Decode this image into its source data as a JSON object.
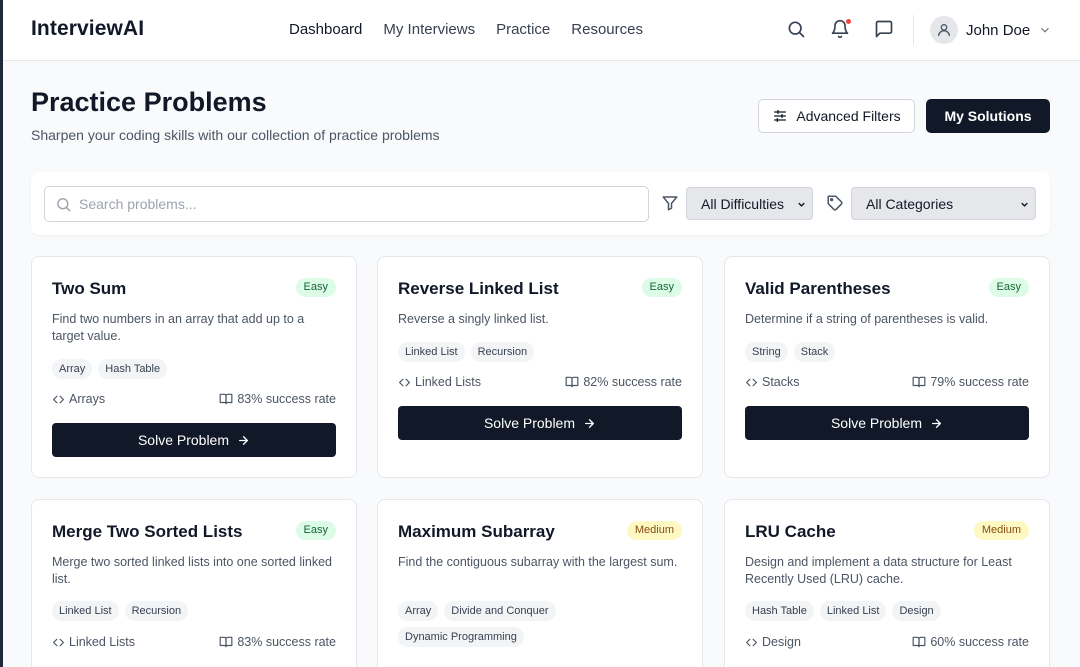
{
  "header": {
    "brand": "InterviewAI",
    "nav": [
      "Dashboard",
      "My Interviews",
      "Practice",
      "Resources"
    ],
    "active_nav": "Dashboard",
    "user_name": "John Doe",
    "notification_dot_color": "#ef4444"
  },
  "page": {
    "title": "Practice Problems",
    "subtitle": "Sharpen your coding skills with our collection of practice problems",
    "advanced_filters_label": "Advanced Filters",
    "my_solutions_label": "My Solutions"
  },
  "filters": {
    "search_placeholder": "Search problems...",
    "search_value": "",
    "difficulty_selected": "All Difficulties",
    "category_selected": "All Categories"
  },
  "colors": {
    "primary": "#111827",
    "easy_bg": "#dcfce7",
    "easy_text": "#166534",
    "medium_bg": "#fef9c3",
    "medium_text": "#854d0e"
  },
  "solve_label": "Solve Problem",
  "problems": [
    {
      "title": "Two Sum",
      "difficulty": "Easy",
      "description": "Find two numbers in an array that add up to a target value.",
      "tags": [
        "Array",
        "Hash Table"
      ],
      "category": "Arrays",
      "success_rate": "83% success rate"
    },
    {
      "title": "Reverse Linked List",
      "difficulty": "Easy",
      "description": "Reverse a singly linked list.",
      "tags": [
        "Linked List",
        "Recursion"
      ],
      "category": "Linked Lists",
      "success_rate": "82% success rate"
    },
    {
      "title": "Valid Parentheses",
      "difficulty": "Easy",
      "description": "Determine if a string of parentheses is valid.",
      "tags": [
        "String",
        "Stack"
      ],
      "category": "Stacks",
      "success_rate": "79% success rate"
    },
    {
      "title": "Merge Two Sorted Lists",
      "difficulty": "Easy",
      "description": "Merge two sorted linked lists into one sorted linked list.",
      "tags": [
        "Linked List",
        "Recursion"
      ],
      "category": "Linked Lists",
      "success_rate": "83% success rate"
    },
    {
      "title": "Maximum Subarray",
      "difficulty": "Medium",
      "description": "Find the contiguous subarray with the largest sum.",
      "tags": [
        "Array",
        "Divide and Conquer",
        "Dynamic Programming"
      ],
      "category": "",
      "success_rate": ""
    },
    {
      "title": "LRU Cache",
      "difficulty": "Medium",
      "description": "Design and implement a data structure for Least Recently Used (LRU) cache.",
      "tags": [
        "Hash Table",
        "Linked List",
        "Design"
      ],
      "category": "Design",
      "success_rate": "60% success rate"
    }
  ]
}
